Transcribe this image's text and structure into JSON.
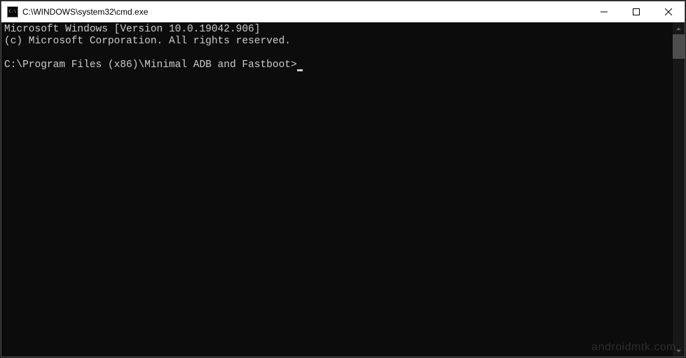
{
  "titlebar": {
    "title": "C:\\WINDOWS\\system32\\cmd.exe"
  },
  "terminal": {
    "line1": "Microsoft Windows [Version 10.0.19042.906]",
    "line2": "(c) Microsoft Corporation. All rights reserved.",
    "blank": "",
    "prompt": "C:\\Program Files (x86)\\Minimal ADB and Fastboot>"
  },
  "watermark": "androidmtk.com"
}
